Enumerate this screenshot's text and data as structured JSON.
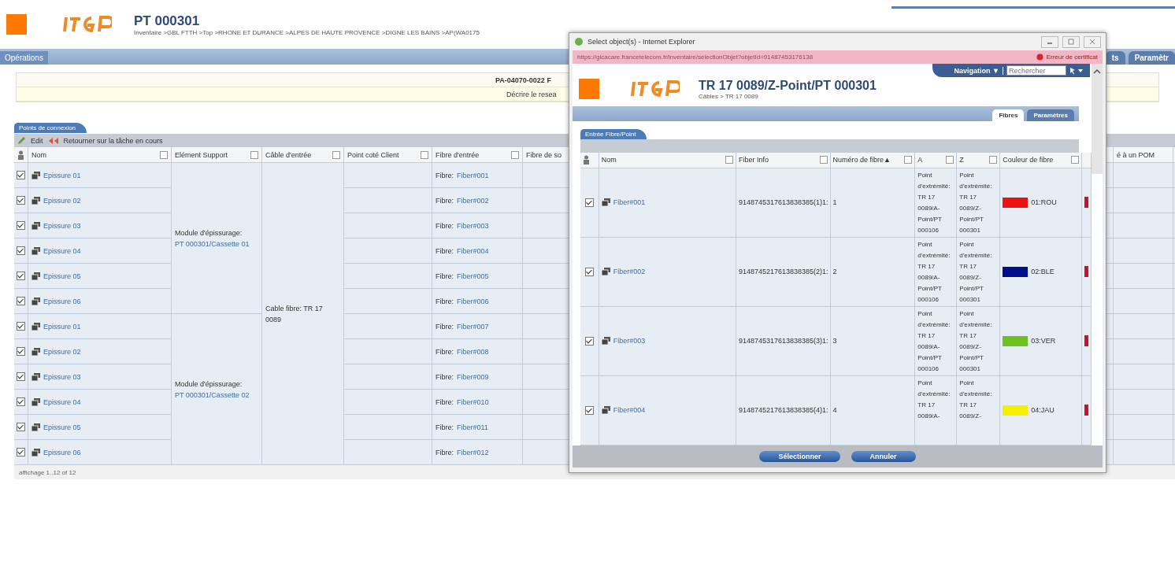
{
  "header": {
    "title": "PT 000301",
    "breadcrumb": "Inventaire >GBL FTTH >Top >RHONE ET DURANCE >ALPES DE HAUTE PROVENCE >DIGNE LES BAINS >AP(WA0175"
  },
  "nav_tabs": [
    {
      "label": "Opérations",
      "selected": true
    }
  ],
  "right_tabs": [
    {
      "label": "ts",
      "selected": false
    },
    {
      "label": "Paramètr",
      "selected": false
    }
  ],
  "info": {
    "reference": "PA-04070-0022 F",
    "description": "Décrire le resea"
  },
  "panel": {
    "tab": "Points de connexion",
    "toolbar": [
      {
        "kind": "edit",
        "label": "Edit"
      },
      {
        "kind": "return",
        "label": "Retourner sur la tâche en cours"
      }
    ],
    "columns": [
      "Nom",
      "Elément Support",
      "Câble d'entrée",
      "Point coté Client",
      "Fibre d'entrée",
      "Fibre de so",
      "é à un POM"
    ],
    "supports": [
      {
        "label": "Module d'épissurage: ",
        "link": "PT 000301/Cassette 01"
      },
      {
        "label": "Module d'épissurage: ",
        "link": "PT 000301/Cassette 02"
      }
    ],
    "cable": "Cable fibre: TR 17 0089",
    "rows": [
      {
        "checked": true,
        "name": "Epissure 01",
        "fibre_label": "Fibre: ",
        "fibre": "Fiber#001"
      },
      {
        "checked": true,
        "name": "Epissure 02",
        "fibre_label": "Fibre: ",
        "fibre": "Fiber#002"
      },
      {
        "checked": true,
        "name": "Epissure 03",
        "fibre_label": "Fibre: ",
        "fibre": "Fiber#003"
      },
      {
        "checked": true,
        "name": "Epissure 04",
        "fibre_label": "Fibre: ",
        "fibre": "Fiber#004"
      },
      {
        "checked": true,
        "name": "Epissure 05",
        "fibre_label": "Fibre: ",
        "fibre": "Fiber#005"
      },
      {
        "checked": true,
        "name": "Epissure 06",
        "fibre_label": "Fibre: ",
        "fibre": "Fiber#006"
      },
      {
        "checked": true,
        "name": "Epissure 01",
        "fibre_label": "Fibre: ",
        "fibre": "Fiber#007"
      },
      {
        "checked": true,
        "name": "Epissure 02",
        "fibre_label": "Fibre: ",
        "fibre": "Fiber#008"
      },
      {
        "checked": true,
        "name": "Epissure 03",
        "fibre_label": "Fibre: ",
        "fibre": "Fiber#009"
      },
      {
        "checked": true,
        "name": "Epissure 04",
        "fibre_label": "Fibre: ",
        "fibre": "Fiber#010"
      },
      {
        "checked": true,
        "name": "Epissure 05",
        "fibre_label": "Fibre: ",
        "fibre": "Fiber#011"
      },
      {
        "checked": true,
        "name": "Epissure 06",
        "fibre_label": "Fibre: ",
        "fibre": "Fiber#012"
      }
    ],
    "footer": "affichage 1..12 of 12"
  },
  "popup": {
    "window_title": "Select object(s) - Internet Explorer",
    "address": "https://gicacare.francetelecom.fr/inventaire/selectionObjet?objetId=91487453176138",
    "certificate": "Erreur de certificat",
    "navigation": "Navigation ▼",
    "search": {
      "placeholder": "Rechercher"
    },
    "title": "TR 17 0089/Z-Point/PT 000301",
    "breadcrumb": "Câbles > TR 17 0089",
    "tabs": [
      {
        "label": "Fibres",
        "selected": true
      },
      {
        "label": "Paramètres",
        "selected": false
      }
    ],
    "subtab": "Entrée Fibre/Point",
    "columns": [
      "Nom",
      "Fiber Info",
      "Numéro de fibre▲",
      "A",
      "Z",
      "Couleur de fibre"
    ],
    "rows": [
      {
        "checked": true,
        "name": "Fiber#001",
        "info": "9148745317613838385(1)1:",
        "number": "1",
        "a": "Point d'extrémité: TR 17 0089/A-Point/PT 000106",
        "z": "Point d'extrémité: TR 17 0089/Z-Point/PT 000301",
        "color": "#ee1111",
        "color_label": "01:ROU"
      },
      {
        "checked": true,
        "name": "Fiber#002",
        "info": "9148745217613838385(2)1:",
        "number": "2",
        "a": "Point d'extrémité: TR 17 0089/A-Point/PT 000106",
        "z": "Point d'extrémité: TR 17 0089/Z-Point/PT 000301",
        "color": "#000e8c",
        "color_label": "02:BLE"
      },
      {
        "checked": true,
        "name": "Fiber#003",
        "info": "9148745317613838385(3)1:",
        "number": "3",
        "a": "Point d'extrémité: TR 17 0089/A-Point/PT 000106",
        "z": "Point d'extrémité: TR 17 0089/Z-Point/PT 000301",
        "color": "#6cc21e",
        "color_label": "03:VER"
      },
      {
        "checked": true,
        "name": "Fiber#004",
        "info": "9148745217613838385(4)1:",
        "number": "4",
        "a": "Point d'extrémité: TR 17 0089/A-",
        "z": "Point d'extrémité: TR 17 0089/Z-",
        "color": "#f5f000",
        "color_label": "04:JAU"
      }
    ],
    "buttons": [
      "Sélectionner",
      "Annuler"
    ]
  }
}
